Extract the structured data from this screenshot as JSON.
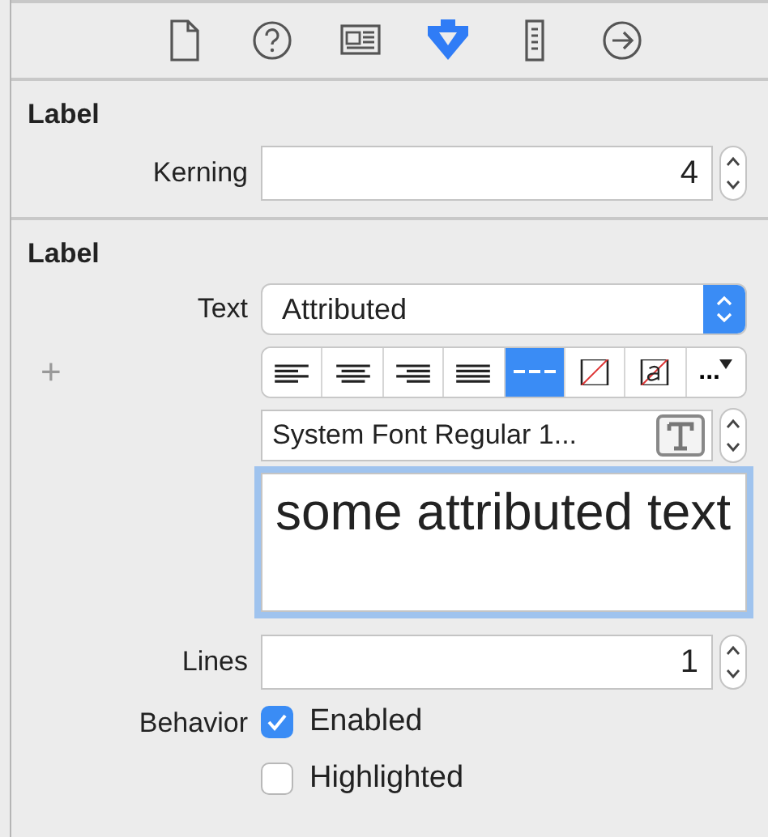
{
  "tabs": [
    {
      "selected": false
    },
    {
      "selected": false
    },
    {
      "selected": false
    },
    {
      "selected": true
    },
    {
      "selected": false
    },
    {
      "selected": false
    }
  ],
  "sections": [
    {
      "title": "Label",
      "rows": [
        {
          "kind": "stepper",
          "label": "Kerning",
          "value": "4"
        }
      ]
    },
    {
      "title": "Label",
      "rows": [
        {
          "kind": "popup",
          "label": "Text",
          "value": "Attributed"
        },
        {
          "kind": "segmented",
          "accessory": "+",
          "segments": [
            {
              "selected": false
            },
            {
              "selected": false
            },
            {
              "selected": false
            },
            {
              "selected": false
            },
            {
              "selected": true
            },
            {
              "selected": false
            },
            {
              "selected": false
            },
            {
              "selected": false,
              "text": "..."
            }
          ]
        },
        {
          "kind": "font",
          "value": "System Font Regular 1..."
        },
        {
          "kind": "textarea",
          "value": "some attributed text",
          "focused": true
        },
        {
          "kind": "stepper",
          "label": "Lines",
          "value": "1"
        },
        {
          "kind": "checkbox",
          "label": "Behavior",
          "text": "Enabled",
          "checked": true
        },
        {
          "kind": "checkbox",
          "text": "Highlighted",
          "checked": false
        }
      ]
    }
  ]
}
